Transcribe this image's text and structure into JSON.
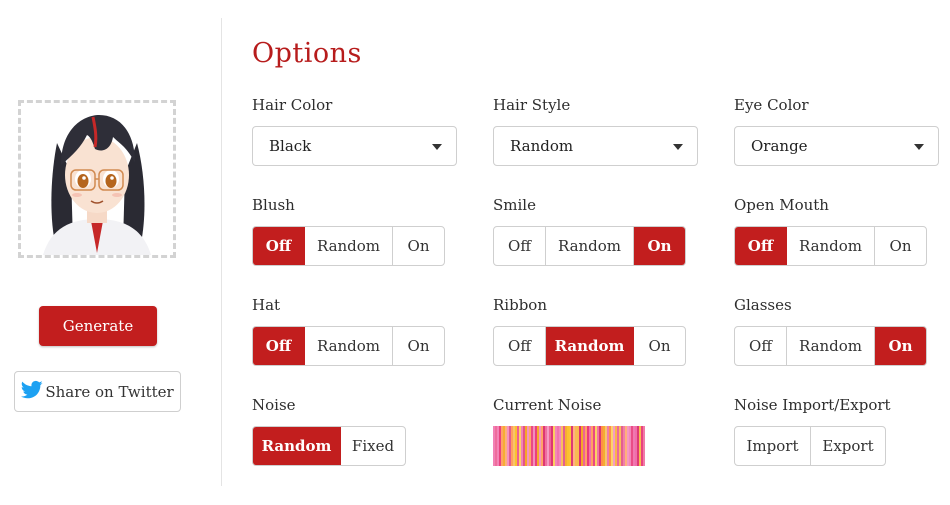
{
  "left": {
    "generate_label": "Generate",
    "twitter_label": "Share on Twitter"
  },
  "options": {
    "title": "Options",
    "hair_color": {
      "label": "Hair Color",
      "value": "Black"
    },
    "hair_style": {
      "label": "Hair Style",
      "value": "Random"
    },
    "eye_color": {
      "label": "Eye Color",
      "value": "Orange"
    },
    "blush": {
      "label": "Blush",
      "options": [
        "Off",
        "Random",
        "On"
      ],
      "selected": "Off"
    },
    "smile": {
      "label": "Smile",
      "options": [
        "Off",
        "Random",
        "On"
      ],
      "selected": "On"
    },
    "open_mouth": {
      "label": "Open Mouth",
      "options": [
        "Off",
        "Random",
        "On"
      ],
      "selected": "Off"
    },
    "hat": {
      "label": "Hat",
      "options": [
        "Off",
        "Random",
        "On"
      ],
      "selected": "Off"
    },
    "ribbon": {
      "label": "Ribbon",
      "options": [
        "Off",
        "Random",
        "On"
      ],
      "selected": "Random"
    },
    "glasses": {
      "label": "Glasses",
      "options": [
        "Off",
        "Random",
        "On"
      ],
      "selected": "On"
    },
    "noise": {
      "label": "Noise",
      "options": [
        "Random",
        "Fixed"
      ],
      "selected": "Random"
    },
    "current_noise": {
      "label": "Current Noise"
    },
    "noise_io": {
      "label": "Noise Import/Export",
      "import_label": "Import",
      "export_label": "Export"
    }
  },
  "colors": {
    "accent": "#c21e1e",
    "title": "#b71c1c",
    "twitter": "#1da1f2",
    "noise_palette": [
      "#e83a7a",
      "#f5a623",
      "#f06ba8",
      "#ff8a3d",
      "#d81b60",
      "#fbc02d"
    ]
  },
  "icons": {
    "twitter": "twitter-bird-icon",
    "dropdown": "chevron-down-icon"
  }
}
